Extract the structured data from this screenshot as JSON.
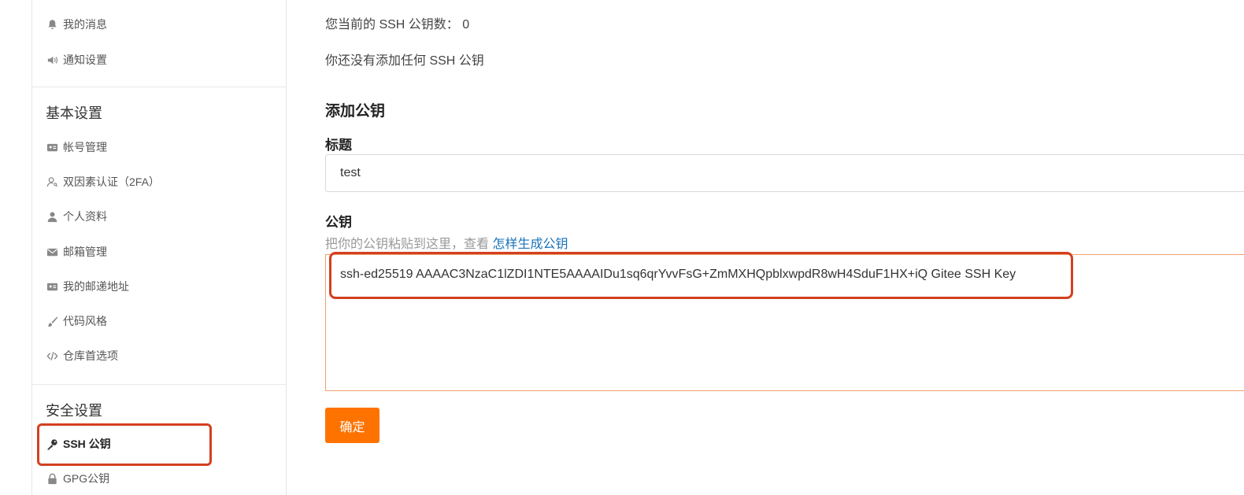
{
  "sidebar": {
    "top_items": [
      {
        "label": "我的消息",
        "icon": "bell-icon"
      },
      {
        "label": "通知设置",
        "icon": "speaker-icon"
      }
    ],
    "sections": [
      {
        "title": "基本设置",
        "items": [
          {
            "label": "帐号管理",
            "icon": "id-card-icon"
          },
          {
            "label": "双因素认证（2FA）",
            "icon": "user-key-icon"
          },
          {
            "label": "个人资料",
            "icon": "user-icon"
          },
          {
            "label": "邮箱管理",
            "icon": "envelope-icon"
          },
          {
            "label": "我的邮递地址",
            "icon": "address-card-icon"
          },
          {
            "label": "代码风格",
            "icon": "paintbrush-icon"
          },
          {
            "label": "仓库首选项",
            "icon": "code-icon"
          }
        ]
      },
      {
        "title": "安全设置",
        "items": [
          {
            "label": "SSH 公钥",
            "icon": "key-icon",
            "active": true
          },
          {
            "label": "GPG公钥",
            "icon": "lock-icon"
          }
        ]
      }
    ]
  },
  "main": {
    "count_label": "您当前的 SSH 公钥数：",
    "count_value": "0",
    "empty_message": "你还没有添加任何 SSH 公钥",
    "add_title": "添加公钥",
    "title_label": "标题",
    "title_value": "test",
    "key_label": "公钥",
    "key_hint_prefix": "把你的公钥粘贴到这里，查看",
    "key_hint_link": "怎样生成公钥",
    "key_value": "ssh-ed25519 AAAAC3NzaC1lZDI1NTE5AAAAIDu1sq6qrYvvFsG+ZmMXHQpblxwpdR8wH4SduF1HX+iQ Gitee SSH Key",
    "submit_label": "确定"
  },
  "colors": {
    "accent": "#fe7300",
    "highlight": "#d3401f",
    "link": "#1a73b8"
  }
}
